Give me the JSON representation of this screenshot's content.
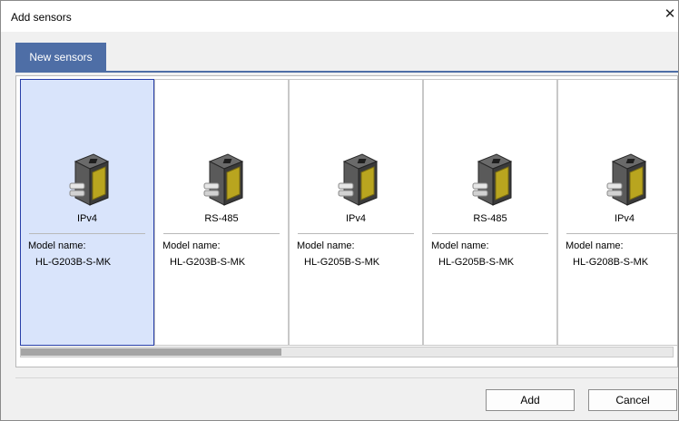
{
  "window": {
    "title": "Add sensors",
    "close_glyph": "✕"
  },
  "tabs": [
    {
      "label": "New sensors",
      "active": true
    }
  ],
  "sensors": [
    {
      "interface": "IPv4",
      "model_label": "Model name:",
      "model_name": "HL-G203B-S-MK",
      "selected": true,
      "icon": "sensor-icon"
    },
    {
      "interface": "RS-485",
      "model_label": "Model name:",
      "model_name": "HL-G203B-S-MK",
      "selected": false,
      "icon": "sensor-icon"
    },
    {
      "interface": "IPv4",
      "model_label": "Model name:",
      "model_name": "HL-G205B-S-MK",
      "selected": false,
      "icon": "sensor-icon"
    },
    {
      "interface": "RS-485",
      "model_label": "Model name:",
      "model_name": "HL-G205B-S-MK",
      "selected": false,
      "icon": "sensor-icon"
    },
    {
      "interface": "IPv4",
      "model_label": "Model name:",
      "model_name": "HL-G208B-S-MK",
      "selected": false,
      "icon": "sensor-icon"
    }
  ],
  "scroll": {
    "horizontal_position_fraction": 0.0,
    "visible_fraction": 0.4
  },
  "buttons": {
    "add_label": "Add",
    "cancel_label": "Cancel"
  },
  "colors": {
    "accent": "#4e6ea6",
    "selection_bg": "#d9e4fb",
    "selection_border": "#283ea8",
    "sensor_face": "#b9a51f",
    "sensor_body": "#3b3b3b"
  }
}
